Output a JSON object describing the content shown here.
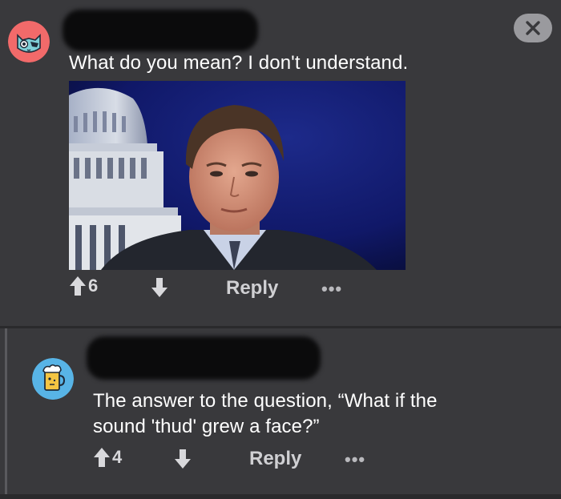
{
  "comments": [
    {
      "avatar": "cat-avatar-icon",
      "avatar_color": "#f26a6a",
      "text": "What do you mean? I don't understand.",
      "upvotes": "6",
      "reply_label": "Reply",
      "more_label": "•••",
      "has_image": true
    },
    {
      "avatar": "beer-avatar-icon",
      "avatar_color": "#58b4e6",
      "text_line1": "The answer to the question, “What if the",
      "text_line2": "sound 'thud' grew a face?”",
      "upvotes": "4",
      "reply_label": "Reply",
      "more_label": "•••"
    }
  ],
  "close_icon": "close-icon",
  "colors": {
    "background": "#39393c",
    "separator": "#2a2a2c",
    "close_button": "#9a9a9e"
  }
}
